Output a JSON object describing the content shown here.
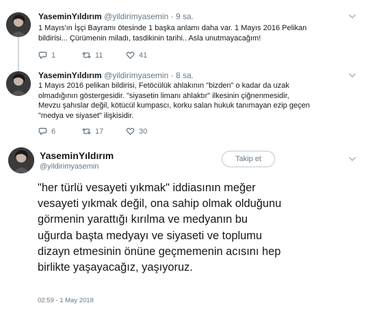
{
  "tweets": [
    {
      "name": "YaseminYıldırım",
      "handle": "@yildirimyasemin",
      "dot": "·",
      "time": "9 sa.",
      "text": "1 Mayıs'ın İşçi Bayramı ötesinde 1 başka anlamı daha var. 1 Mayıs 2016 Pelikan bildirisi... Çürümenin miladı, tasdikinin tarihi.. Asla unutmayacağım!",
      "replies": "1",
      "retweets": "11",
      "likes": "41"
    },
    {
      "name": "YaseminYıldırım",
      "handle": "@yildirimyasemin",
      "dot": "·",
      "time": "8 sa.",
      "text": "1 Mayıs 2016 pelikan bildirisi, Fetöcülük ahlakının \"bizden\" o kadar da uzak olmadığının göstergesidir. \"siyasetin limanı ahlaktır\" ilkesinin çiğnenmesidir, Mevzu şahıslar değil, kötücül kumpascı, korku salan hukuk tanımayan ezip geçen \"medya ve siyaset\" ilişkisidir.",
      "replies": "6",
      "retweets": "17",
      "likes": "30"
    }
  ],
  "main_tweet": {
    "name": "YaseminYıldırım",
    "handle": "@yildirimyasemin",
    "follow_label": "Takip et",
    "text": "\"her türlü vesayeti yıkmak\" iddiasının meğer vesayeti yıkmak değil, ona sahip olmak olduğunu görmenin yarattığı kırılma ve medyanın bu uğurda başta medyayı ve siyaseti ve toplumu dizayn etmesinin önüne geçmemenin acısını hep birlikte yaşayacağız, yaşıyoruz.",
    "timestamp": "02:59 - 1 May 2018"
  },
  "icons": {
    "reply": "reply-icon",
    "retweet": "retweet-icon",
    "like": "heart-icon",
    "menu": "chevron-down-icon"
  },
  "colors": {
    "text": "#14171a",
    "secondary": "#657786",
    "thread_line": "#ccd6dd"
  }
}
